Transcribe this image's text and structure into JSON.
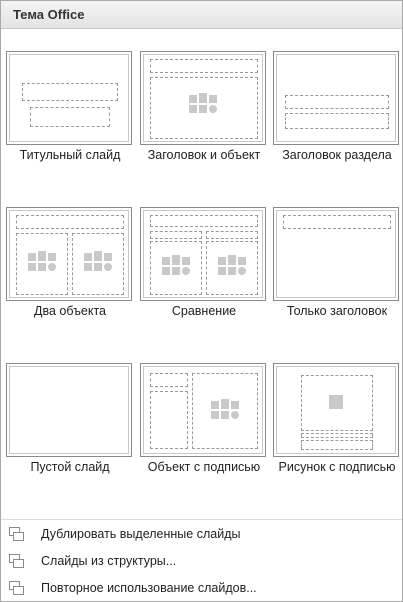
{
  "header": {
    "title": "Тема Office"
  },
  "layouts": [
    {
      "label": "Титульный слайд",
      "type": "title"
    },
    {
      "label": "Заголовок и объект",
      "type": "title-content"
    },
    {
      "label": "Заголовок раздела",
      "type": "section"
    },
    {
      "label": "Два объекта",
      "type": "two-content"
    },
    {
      "label": "Сравнение",
      "type": "comparison"
    },
    {
      "label": "Только заголовок",
      "type": "title-only"
    },
    {
      "label": "Пустой слайд",
      "type": "blank"
    },
    {
      "label": "Объект с подписью",
      "type": "content-caption"
    },
    {
      "label": "Рисунок с подписью",
      "type": "picture-caption"
    }
  ],
  "commands": [
    {
      "label": "Дублировать выделенные слайды",
      "icon": "duplicate-slides-icon"
    },
    {
      "label": "Слайды из структуры...",
      "icon": "slides-from-outline-icon"
    },
    {
      "label": "Повторное использование слайдов...",
      "icon": "reuse-slides-icon"
    }
  ]
}
